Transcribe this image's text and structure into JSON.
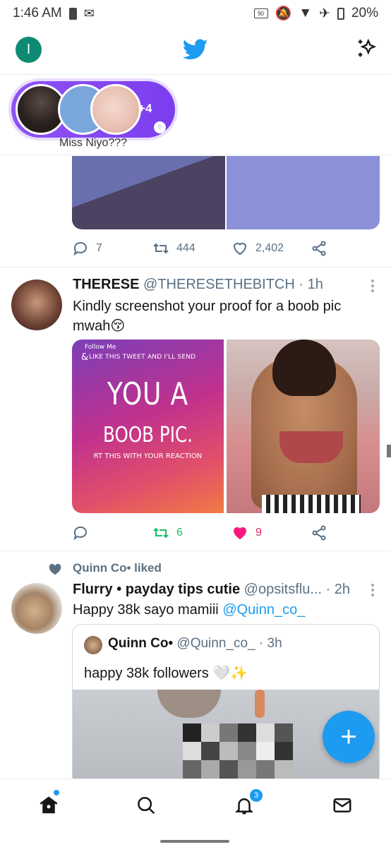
{
  "status_bar": {
    "time": "1:46 AM",
    "refresh_rate": "90",
    "battery": "20%"
  },
  "top_bar": {
    "account_initial": "I"
  },
  "fleets": {
    "extra_count": "+4",
    "name": "Miss Niyo???"
  },
  "tweet1": {
    "replies": "7",
    "retweets": "444",
    "likes": "2,402"
  },
  "tweet2": {
    "display_name": "THERESE",
    "handle": "@THERESETHEBITCH",
    "time": "· 1h",
    "text": "Kindly screenshot your proof for a boob pic mwah😚",
    "promo": {
      "follow": "Follow Me",
      "amp": "&",
      "like_line": "LIKE THIS TWEET AND I'LL SEND",
      "you_a": "YOU A",
      "boob_pic": "BOOB PIC.",
      "rt_line": "RT THIS WITH YOUR REACTION"
    },
    "retweets": "6",
    "likes": "9"
  },
  "tweet3": {
    "liked_by": "Quinn Co• liked",
    "display_name": "Flurry • payday tips cutie",
    "handle": "@opsitsflu...",
    "time": "· 2h",
    "text_prefix": "Happy 38k sayo mamiii ",
    "mention": "@Quinn_co_",
    "quote": {
      "display_name": "Quinn Co•",
      "handle": "@Quinn_co_",
      "time": "· 3h",
      "text": "happy 38k followers 🤍✨"
    }
  },
  "nav": {
    "notification_count": "3"
  },
  "colors": {
    "accent": "#1d9bf0",
    "like": "#e0245e",
    "retweet": "#17bf63",
    "fleet": "#7c3df0"
  }
}
